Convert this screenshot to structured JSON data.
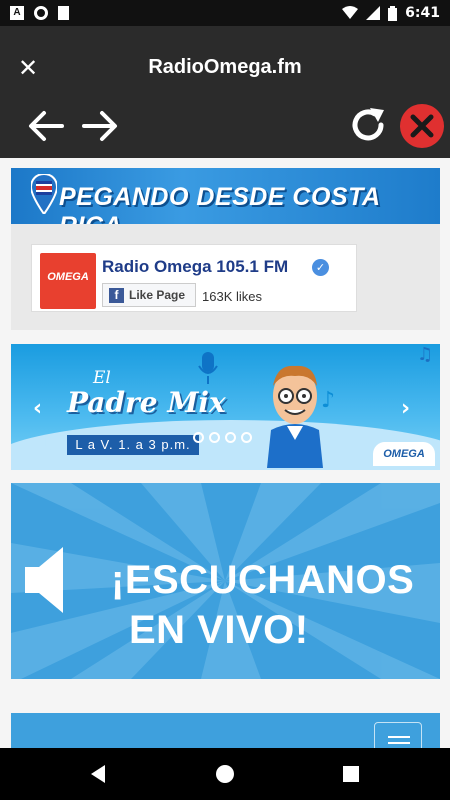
{
  "status_bar": {
    "time": "6:41",
    "icons": [
      "a-icon",
      "circle-icon",
      "sd-card-icon",
      "wifi-icon",
      "signal-icon",
      "battery-icon"
    ]
  },
  "browser": {
    "title": "RadioOmega.fm",
    "close_label": "✕",
    "back_icon": "arrow-left-icon",
    "forward_icon": "arrow-right-icon",
    "reload_icon": "reload-icon",
    "stop_icon": "stop-icon"
  },
  "banner_costa_rica": {
    "text": "PEGANDO DESDE COSTA RICA"
  },
  "facebook_widget": {
    "page_name": "Radio Omega 105.1 FM",
    "like_button": "Like Page",
    "likes": "163K likes",
    "logo_text": "OMEGA"
  },
  "slider": {
    "el": "El",
    "show": "Padre Mix",
    "schedule": "L a V. 1. a 3 p.m.",
    "dots": 4,
    "logo_text": "OMEGA"
  },
  "live": {
    "line1": "¡ESCUCHANOS",
    "line2": "EN VIVO!"
  },
  "colors": {
    "toolbar": "#2b2b2b",
    "stop_button": "#e03030",
    "brand_blue": "#3ea0dd"
  }
}
